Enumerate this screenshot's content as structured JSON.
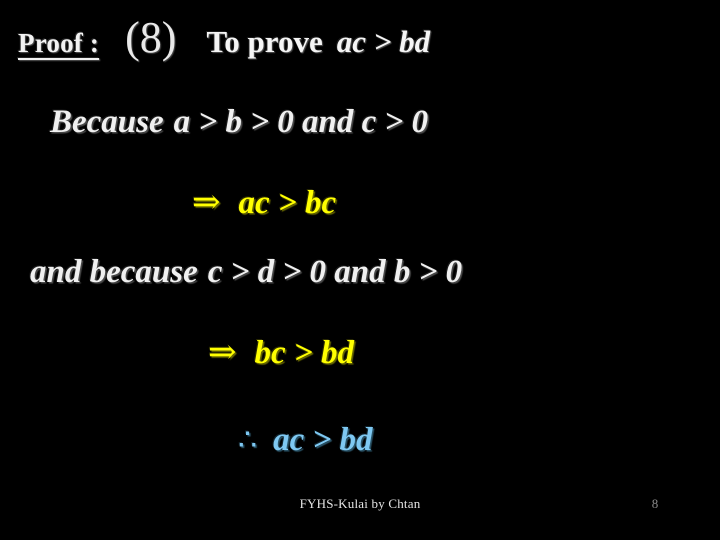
{
  "slide": {
    "background_color": "#000000",
    "header": {
      "proof_label": "Proof :",
      "item_number": "(8)",
      "to_prove_text": "To prove",
      "to_prove_expression": "ac > bd"
    },
    "body_lines": [
      {
        "id": "because",
        "color": "#f0f0f0",
        "prefix": "Because",
        "expression": "a > b > 0 and c > 0",
        "full_text": "Because  a > b > 0  and c > 0"
      },
      {
        "id": "imply1",
        "color": "#ffff00",
        "symbol": "⇒",
        "expression": "ac > bc",
        "full_text": "⇒  ac > bc"
      },
      {
        "id": "and-because",
        "color": "#f0f0f0",
        "prefix": "and because",
        "expression": "c > d > 0 and b > 0",
        "full_text": "and because  c > d > 0  and b > 0"
      },
      {
        "id": "imply2",
        "color": "#ffff00",
        "symbol": "⇒",
        "expression": "bc > bd",
        "full_text": "⇒  bc > bd"
      },
      {
        "id": "therefore",
        "color": "#7ec8f2",
        "symbol": "∴",
        "expression": "ac > bd",
        "full_text": "∴ ac > bd"
      }
    ],
    "symbols": {
      "greater_than": ">",
      "implies": "⇒",
      "therefore": "∴",
      "and_word": "and"
    },
    "footer": {
      "credit": "FYHS-Kulai by Chtan",
      "page_number": "8"
    },
    "colors": {
      "background": "#000000",
      "white_text": "#f0f0f0",
      "yellow_text": "#ffff00",
      "blue_text": "#7ec8f2",
      "footer_credit": "#e6e6e6",
      "footer_page": "#8a8a8a"
    }
  }
}
